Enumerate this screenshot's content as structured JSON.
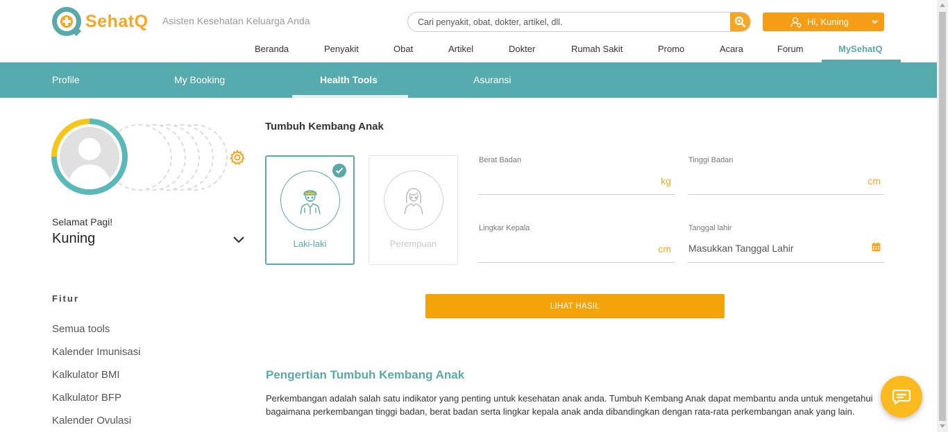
{
  "brand": {
    "name": "SehatQ",
    "tagline": "Asisten Kesehatan Keluarga Anda"
  },
  "search": {
    "placeholder": "Cari penyakit, obat, dokter, artikel, dll."
  },
  "user_menu": {
    "label": "Hi, Kuning"
  },
  "main_nav": [
    "Beranda",
    "Penyakit",
    "Obat",
    "Artikel",
    "Dokter",
    "Rumah Sakit",
    "Promo",
    "Acara",
    "Forum",
    "MySehatQ"
  ],
  "main_nav_active": "MySehatQ",
  "sub_nav": [
    "Profile",
    "My Booking",
    "Health Tools",
    "Asuransi"
  ],
  "sub_nav_active": "Health Tools",
  "sidebar": {
    "greeting": "Selamat Pagi!",
    "username": "Kuning",
    "features_heading": "Fitur",
    "links": [
      "Semua tools",
      "Kalender Imunisasi",
      "Kalkulator BMI",
      "Kalkulator BFP",
      "Kalender Ovulasi"
    ]
  },
  "tool": {
    "title": "Tumbuh Kembang Anak",
    "gender_options": [
      {
        "label": "Laki-laki",
        "selected": true
      },
      {
        "label": "Perempuan",
        "selected": false
      }
    ],
    "fields": {
      "weight": {
        "label": "Berat Badan",
        "unit": "kg",
        "value": ""
      },
      "height": {
        "label": "Tinggi Badan",
        "unit": "cm",
        "value": ""
      },
      "head": {
        "label": "Lingkar Kepala",
        "unit": "cm",
        "value": ""
      },
      "birthdate": {
        "label": "Tanggal lahir",
        "placeholder": "Masukkan Tanggal Lahir"
      }
    },
    "submit_label": "LIHAT HASIL"
  },
  "article": {
    "title": "Pengertian Tumbuh Kembang Anak",
    "body": "Perkembangan adalah salah satu indikator yang penting untuk kesehatan anak anda. Tumbuh Kembang Anak dapat membantu anda untuk mengetahui bagaimana perkembangan tinggi badan, berat badan serta lingkar kepala anak anda dibandingkan dengan rata-rata perkembangan anak yang lain."
  },
  "colors": {
    "teal": "#55abad",
    "orange": "#f5a623",
    "chat": "#f9b91f"
  },
  "icons": [
    "search-icon",
    "user-icon",
    "chevron-down-icon",
    "gear-icon",
    "check-icon",
    "boy-icon",
    "girl-icon",
    "calendar-icon",
    "chat-icon"
  ]
}
